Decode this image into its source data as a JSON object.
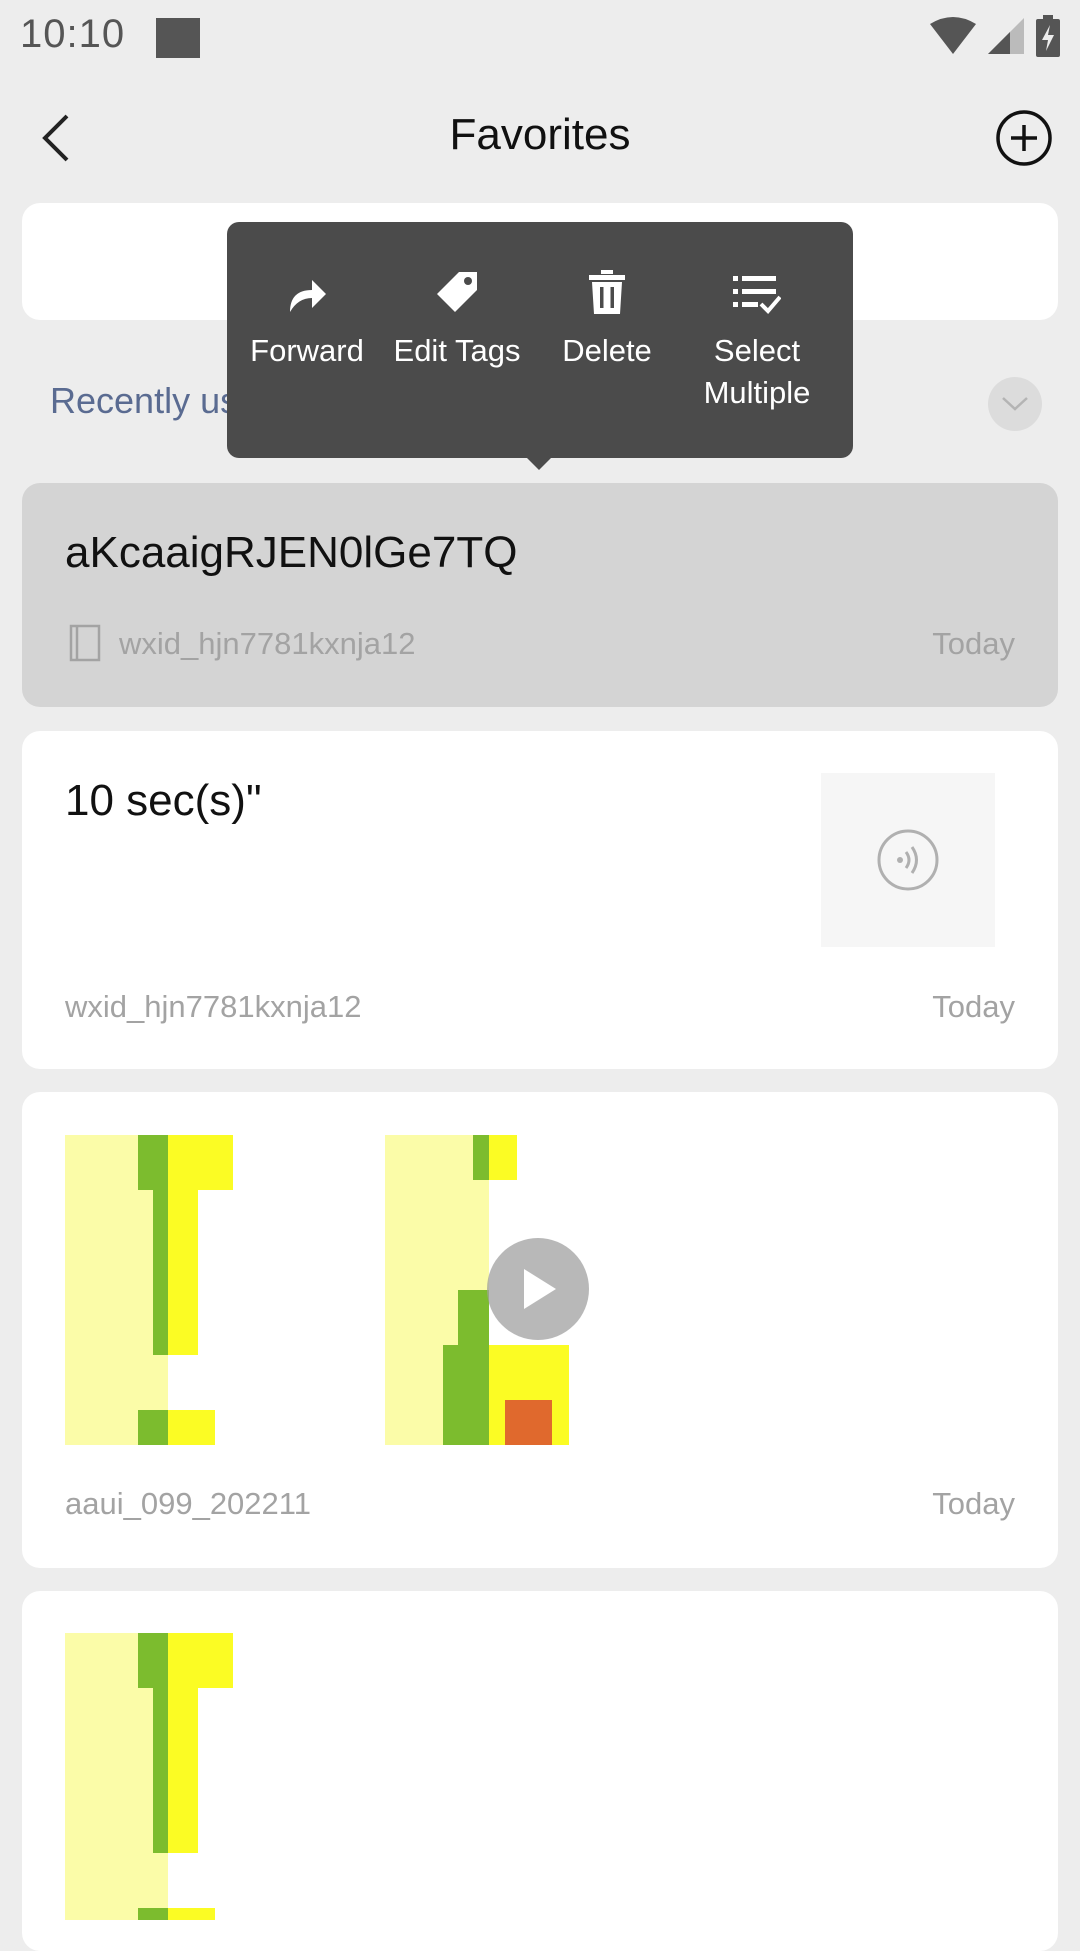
{
  "status_bar": {
    "time": "10:10"
  },
  "header": {
    "title": "Favorites"
  },
  "section": {
    "recently_used_label": "Recently us"
  },
  "popup_menu": {
    "items": [
      {
        "label": "Forward",
        "icon": "forward-icon"
      },
      {
        "label": "Edit Tags",
        "icon": "tag-icon"
      },
      {
        "label": "Delete",
        "icon": "trash-icon"
      },
      {
        "label": "Select Multiple",
        "icon": "select-multiple-icon"
      }
    ]
  },
  "favorites": [
    {
      "title": "aKcaaigRJEN0lGe7TQ",
      "source": "wxid_hjn7781kxnja12",
      "date": "Today",
      "type": "note"
    },
    {
      "title": "10 sec(s)\"",
      "source": "wxid_hjn7781kxnja12",
      "date": "Today",
      "type": "voice"
    },
    {
      "source": "aaui_099_202211",
      "date": "Today",
      "type": "media"
    },
    {
      "type": "image"
    }
  ],
  "colors": {
    "popup_bg": "#4b4b4b",
    "highlight_card": "#d4d4d4",
    "recent_label": "#5a6b91"
  }
}
